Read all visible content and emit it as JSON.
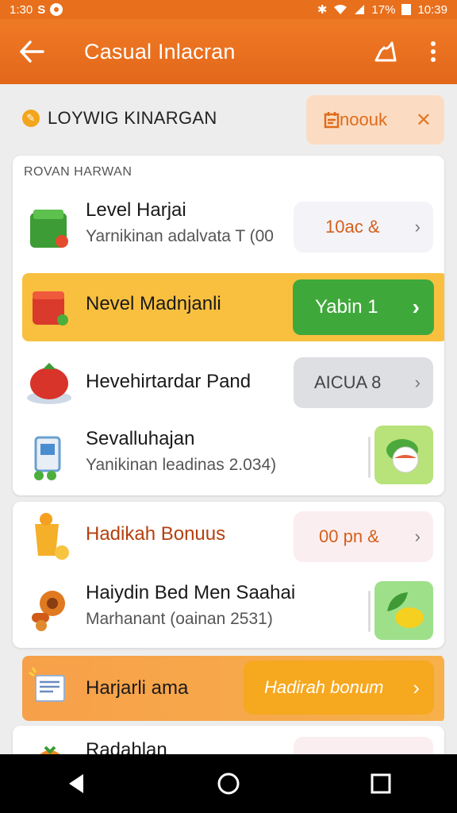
{
  "status_bar": {
    "time": "1:30",
    "battery": "17%",
    "clock": "10:39"
  },
  "app_bar": {
    "title": "Casual Inlacran"
  },
  "filter": {
    "label": "LOYWIG KINARGAN",
    "chip_label": "noouk"
  },
  "section1": {
    "header": "ROVAN HARWAN",
    "rows": [
      {
        "title": "Level Harjai",
        "subtitle": "Yarnikinan adalvata T (00",
        "pill": "10ac &"
      },
      {
        "title": "Nevel Madnjanli",
        "button": "Yabin 1"
      },
      {
        "title": "Hevehirtardar Pand",
        "pill": "AICUA 8"
      },
      {
        "title": "Sevalluhajan",
        "subtitle": "Yanikinan leadinas 2.034)"
      }
    ]
  },
  "section2": {
    "rows": [
      {
        "title": "Hadikah Bonuus",
        "pill": "00 pn &"
      },
      {
        "title": "Haiydin Bed Men Saahai",
        "subtitle": "Marhanant (oainan 2531)"
      }
    ]
  },
  "promo": {
    "title": "Harjarli ama",
    "button": "Hadirah bonum"
  },
  "partial": {
    "title": "Radahlan"
  },
  "colors": {
    "accent": "#e8701c",
    "green": "#3fa83a",
    "amber": "#f6a81f"
  }
}
